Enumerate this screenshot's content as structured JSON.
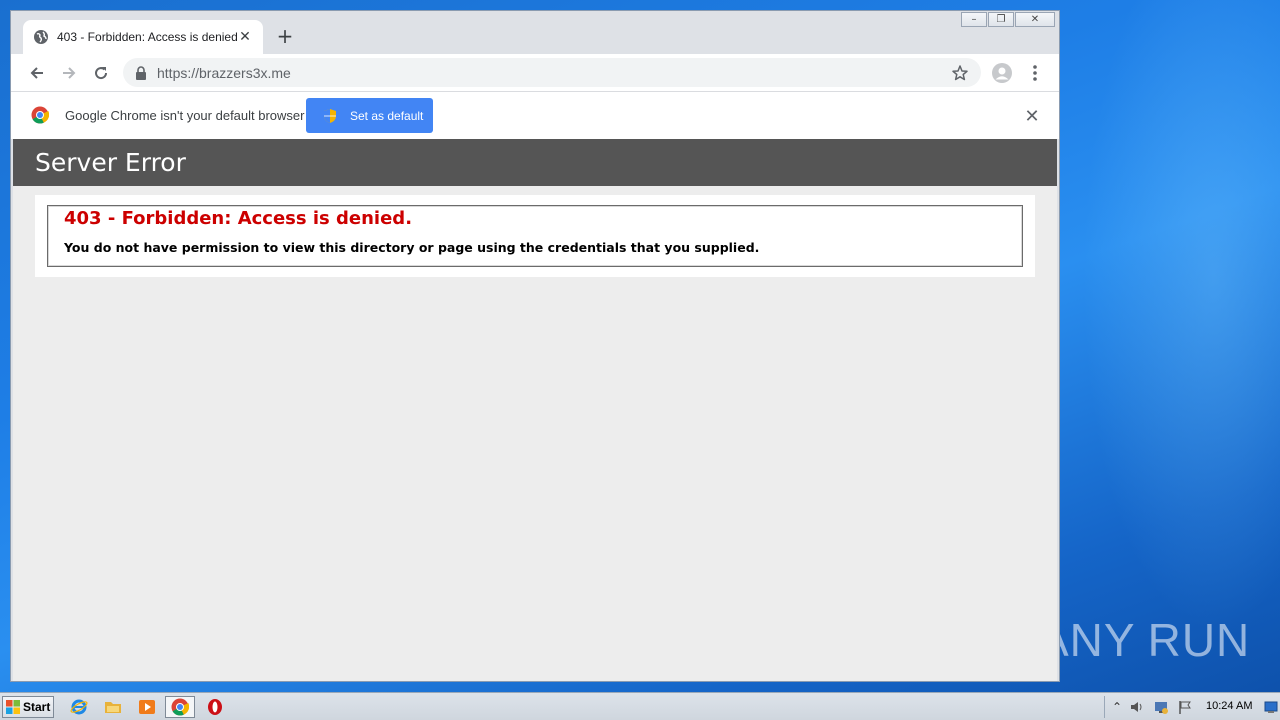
{
  "browser": {
    "tab_title": "403 - Forbidden: Access is denied.",
    "tab_close_glyph": "✕",
    "new_tab_glyph": "+",
    "url": "https://brazzers3x.me",
    "infobar": {
      "message": "Google Chrome isn't your default browser",
      "button_label": "Set as default",
      "close_glyph": "✕"
    },
    "window_controls": {
      "minimize": "–",
      "restore": "❐",
      "close": "✕"
    }
  },
  "page": {
    "header_title": "Server Error",
    "error_title": "403 - Forbidden: Access is denied.",
    "error_message": "You do not have permission to view this directory or page using the credentials that you supplied."
  },
  "taskbar": {
    "start_label": "Start",
    "clock": "10:24 AM",
    "icons": [
      "internet-explorer-icon",
      "folder-icon",
      "media-player-icon",
      "chrome-icon",
      "opera-icon"
    ]
  },
  "watermark": {
    "text_left": "ANY",
    "text_right": "RUN"
  },
  "colors": {
    "error_red": "#cc0000",
    "header_gray": "#555555",
    "button_blue": "#4285f4",
    "page_background": "#ededed"
  }
}
